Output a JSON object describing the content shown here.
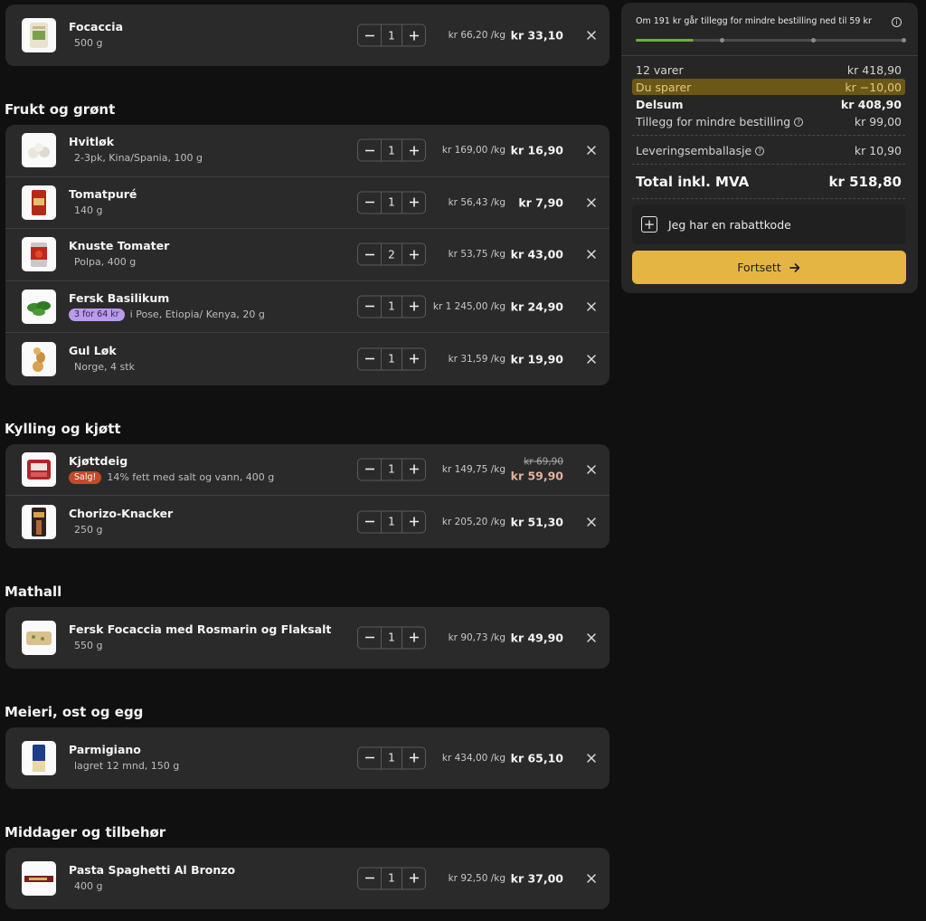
{
  "categories": [
    {
      "title": "",
      "single": true,
      "items": [
        {
          "name": "Focaccia",
          "sub": "500 g",
          "badge": "",
          "qty": "1",
          "unit_price": "kr 66,20 /kg",
          "price": "kr 33,10",
          "old_price": "",
          "thumb": "bread-bag"
        }
      ]
    },
    {
      "title": "Frukt og grønt",
      "single": false,
      "items": [
        {
          "name": "Hvitløk",
          "sub": "2-3pk, Kina/Spania, 100 g",
          "badge": "",
          "qty": "1",
          "unit_price": "kr 169,00 /kg",
          "price": "kr 16,90",
          "old_price": "",
          "thumb": "garlic"
        },
        {
          "name": "Tomatpuré",
          "sub": "140 g",
          "badge": "",
          "qty": "1",
          "unit_price": "kr 56,43 /kg",
          "price": "kr 7,90",
          "old_price": "",
          "thumb": "can-red"
        },
        {
          "name": "Knuste Tomater",
          "sub": "Polpa, 400 g",
          "badge": "",
          "qty": "2",
          "unit_price": "kr 53,75 /kg",
          "price": "kr 43,00",
          "old_price": "",
          "thumb": "can-tomato"
        },
        {
          "name": "Fersk Basilikum",
          "sub": "i Pose, Etiopia/ Kenya, 20 g",
          "badge": "3 for 64 kr",
          "badge_type": "purple",
          "qty": "1",
          "unit_price": "kr 1 245,00 /kg",
          "price": "kr 24,90",
          "old_price": "",
          "thumb": "basil"
        },
        {
          "name": "Gul Løk",
          "sub": "Norge, 4 stk",
          "badge": "",
          "qty": "1",
          "unit_price": "kr 31,59 /kg",
          "price": "kr 19,90",
          "old_price": "",
          "thumb": "onion"
        }
      ]
    },
    {
      "title": "Kylling og kjøtt",
      "single": false,
      "items": [
        {
          "name": "Kjøttdeig",
          "sub": "14% fett med salt og vann, 400 g",
          "badge": "Salg!",
          "badge_type": "red",
          "qty": "1",
          "unit_price": "kr 149,75 /kg",
          "price": "kr 59,90",
          "old_price": "kr 69,90",
          "thumb": "meat"
        },
        {
          "name": "Chorizo-Knacker",
          "sub": "250 g",
          "badge": "",
          "qty": "1",
          "unit_price": "kr 205,20 /kg",
          "price": "kr 51,30",
          "old_price": "",
          "thumb": "sausage"
        }
      ]
    },
    {
      "title": "Mathall",
      "single": true,
      "items": [
        {
          "name": "Fersk Focaccia med Rosmarin og Flaksalt",
          "sub": "550 g",
          "badge": "",
          "qty": "1",
          "unit_price": "kr 90,73 /kg",
          "price": "kr 49,90",
          "old_price": "",
          "thumb": "focaccia"
        }
      ]
    },
    {
      "title": "Meieri, ost og egg",
      "single": true,
      "items": [
        {
          "name": "Parmigiano",
          "sub": "lagret 12 mnd, 150 g",
          "badge": "",
          "qty": "1",
          "unit_price": "kr 434,00 /kg",
          "price": "kr 65,10",
          "old_price": "",
          "thumb": "cheese"
        }
      ]
    },
    {
      "title": "Middager og tilbehør",
      "single": true,
      "items": [
        {
          "name": "Pasta Spaghetti Al Bronzo",
          "sub": "400 g",
          "badge": "",
          "qty": "1",
          "unit_price": "kr 92,50 /kg",
          "price": "kr 37,00",
          "old_price": "",
          "thumb": "pasta"
        }
      ]
    }
  ],
  "summary": {
    "notice": "Om 191 kr går tillegg for mindre bestilling ned til 59 kr",
    "progress_fraction": 0.23,
    "items_label": "12 varer",
    "items_value": "kr 418,90",
    "savings_label": "Du sparer",
    "savings_value": "kr −10,00",
    "subtotal_label": "Delsum",
    "subtotal_value": "kr 408,90",
    "small_order_label": "Tillegg for mindre bestilling",
    "small_order_value": "kr 99,00",
    "packaging_label": "Leveringsemballasje",
    "packaging_value": "kr 10,90",
    "total_label": "Total inkl. MVA",
    "total_value": "kr 518,80",
    "promo_label": "Jeg har en rabattkode",
    "continue_label": "Fortsett"
  },
  "icons": {
    "remove": "close-icon",
    "info": "info-icon",
    "help": "question-icon",
    "add": "plus-square-icon",
    "arrow": "arrow-right-icon"
  },
  "colors": {
    "background": "#101010",
    "card": "#2a2a2a",
    "accent": "#e5b543",
    "progress": "#6bb03a",
    "savings_bg": "#6b5818",
    "badge_purple": "#b99be9",
    "badge_red": "#c4492a"
  }
}
